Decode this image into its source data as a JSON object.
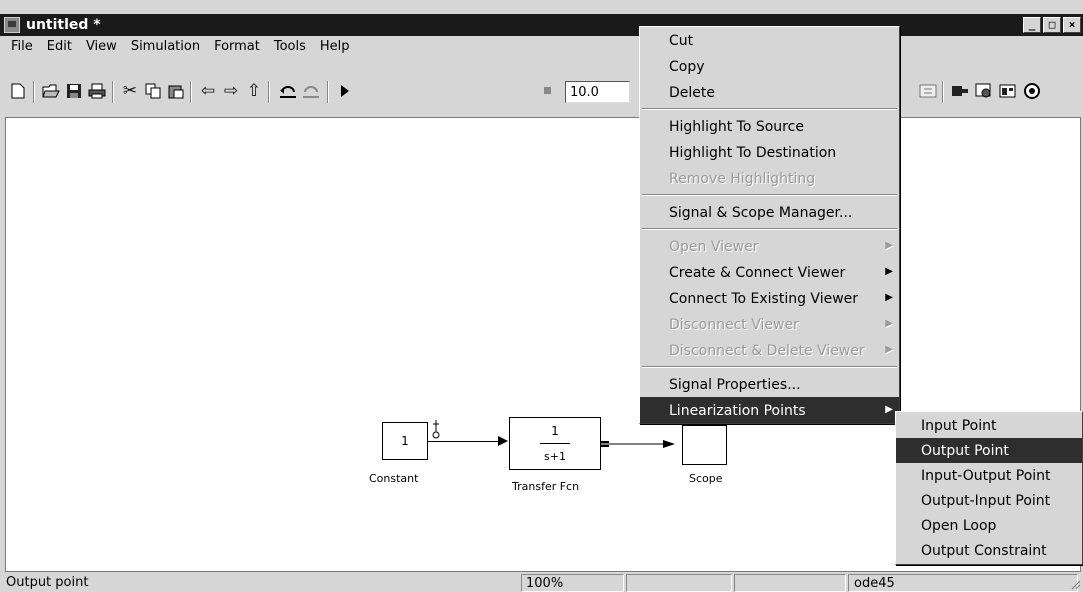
{
  "window": {
    "title": "untitled *",
    "controls": [
      "_",
      "□",
      "×"
    ]
  },
  "menubar": {
    "items": [
      "File",
      "Edit",
      "View",
      "Simulation",
      "Format",
      "Tools",
      "Help"
    ]
  },
  "toolbar": {
    "stop_time": "10.0",
    "icons": [
      "new-file-icon",
      "open-folder-icon",
      "save-icon",
      "print-icon",
      "cut-icon",
      "copy-icon",
      "paste-icon",
      "back-icon",
      "forward-icon",
      "up-icon",
      "undo-icon",
      "redo-icon",
      "play-icon",
      "stop-icon",
      "library-icon",
      "model-browser-icon",
      "debugger-icon",
      "explorer-icon"
    ]
  },
  "model": {
    "constant_value": "1",
    "constant_caption": "Constant",
    "tf_numerator": "1",
    "tf_denominator": "s+1",
    "tf_caption": "Transfer Fcn",
    "scope_caption": "Scope"
  },
  "statusbar": {
    "message": "Output point",
    "zoom": "100%",
    "blank1": "",
    "blank2": "",
    "solver": "ode45"
  },
  "context_menu": {
    "items": [
      {
        "label": "Cut",
        "disabled": false
      },
      {
        "label": "Copy",
        "disabled": false
      },
      {
        "label": "Delete",
        "disabled": false
      },
      {
        "sep": true
      },
      {
        "label": "Highlight To Source",
        "disabled": false
      },
      {
        "label": "Highlight To Destination",
        "disabled": false
      },
      {
        "label": "Remove Highlighting",
        "disabled": true
      },
      {
        "sep": true
      },
      {
        "label": "Signal & Scope Manager...",
        "disabled": false
      },
      {
        "sep": true
      },
      {
        "label": "Open Viewer",
        "disabled": true,
        "submenu": true
      },
      {
        "label": "Create & Connect Viewer",
        "disabled": false,
        "submenu": true
      },
      {
        "label": "Connect To Existing Viewer",
        "disabled": false,
        "submenu": true
      },
      {
        "label": "Disconnect Viewer",
        "disabled": true,
        "submenu": true
      },
      {
        "label": "Disconnect & Delete Viewer",
        "disabled": true,
        "submenu": true
      },
      {
        "sep": true
      },
      {
        "label": "Signal Properties...",
        "disabled": false
      },
      {
        "label": "Linearization Points",
        "disabled": false,
        "submenu": true,
        "active": true
      }
    ]
  },
  "submenu": {
    "items": [
      "Input Point",
      "Output Point",
      "Input-Output Point",
      "Output-Input Point",
      "Open Loop",
      "Output Constraint"
    ],
    "active_index": 1
  }
}
